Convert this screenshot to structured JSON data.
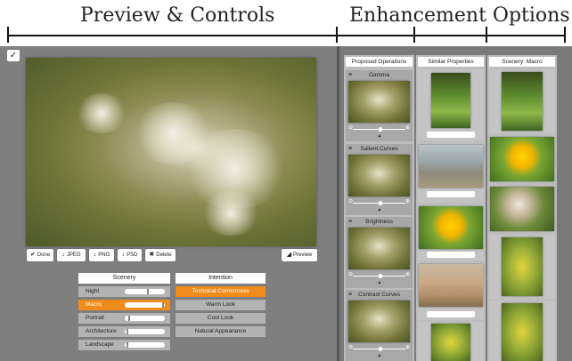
{
  "header": {
    "left_title": "Preview & Controls",
    "right_title": "Enhancement Options"
  },
  "app": {
    "logo_icon": "feather-icon",
    "toolbar": {
      "done": "Done",
      "jpeg": "JPEG",
      "png": "PNG",
      "psd": "PSD",
      "delete": "Delete",
      "preview": "Preview"
    },
    "scenery": {
      "header": "Scenery",
      "rows": [
        {
          "label": "Night",
          "level": 0.55,
          "active": false
        },
        {
          "label": "Macro",
          "level": 0.95,
          "active": true
        },
        {
          "label": "Portrait",
          "level": 0.1,
          "active": false
        },
        {
          "label": "Architecture",
          "level": 0.05,
          "active": false
        },
        {
          "label": "Landscape",
          "level": 0.05,
          "active": false
        }
      ]
    },
    "intention": {
      "header": "Intention",
      "rows": [
        {
          "label": "Technical Correctness",
          "active": true
        },
        {
          "label": "Warm Look",
          "active": false
        },
        {
          "label": "Cool Look",
          "active": false
        },
        {
          "label": "Natural Appearance",
          "active": false
        }
      ]
    },
    "columns": {
      "proposed": {
        "header": "Proposed Operations",
        "ops": [
          "Gamma",
          "Salient Curves",
          "Brightness",
          "Contrast Curves"
        ]
      },
      "similar": {
        "header": "Similar Properties"
      },
      "scenery": {
        "header": "Scenery: Macro"
      }
    }
  }
}
